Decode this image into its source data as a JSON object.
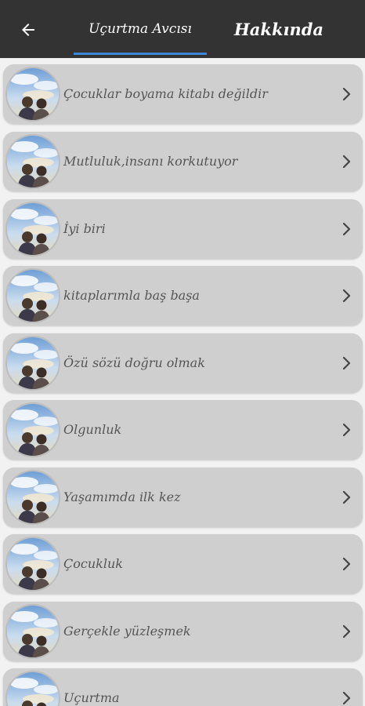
{
  "header": {
    "back_icon": "arrow-left-icon",
    "tabs": [
      {
        "label": "Uçurtma Avcısı",
        "selected": true
      },
      {
        "label": "Hakkında",
        "selected": false
      }
    ],
    "indicator_color": "#3d86d9",
    "background_color": "#333333"
  },
  "list": {
    "items": [
      {
        "title": "Çocuklar boyama kitabı değildir"
      },
      {
        "title": "Mutluluk,insanı korkutuyor"
      },
      {
        "title": "İyi biri"
      },
      {
        "title": "kitaplarımla baş başa"
      },
      {
        "title": "Özü sözü doğru olmak"
      },
      {
        "title": "Olgunluk"
      },
      {
        "title": "Yaşamımda ilk kez"
      },
      {
        "title": "Çocukluk"
      },
      {
        "title": "Gerçekle yüzleşmek"
      },
      {
        "title": "Uçurtma"
      }
    ],
    "thumbnail_icon": "sky-people-thumbnail",
    "chevron_icon": "chevron-right-icon",
    "row_color": "#cfcfcf"
  }
}
